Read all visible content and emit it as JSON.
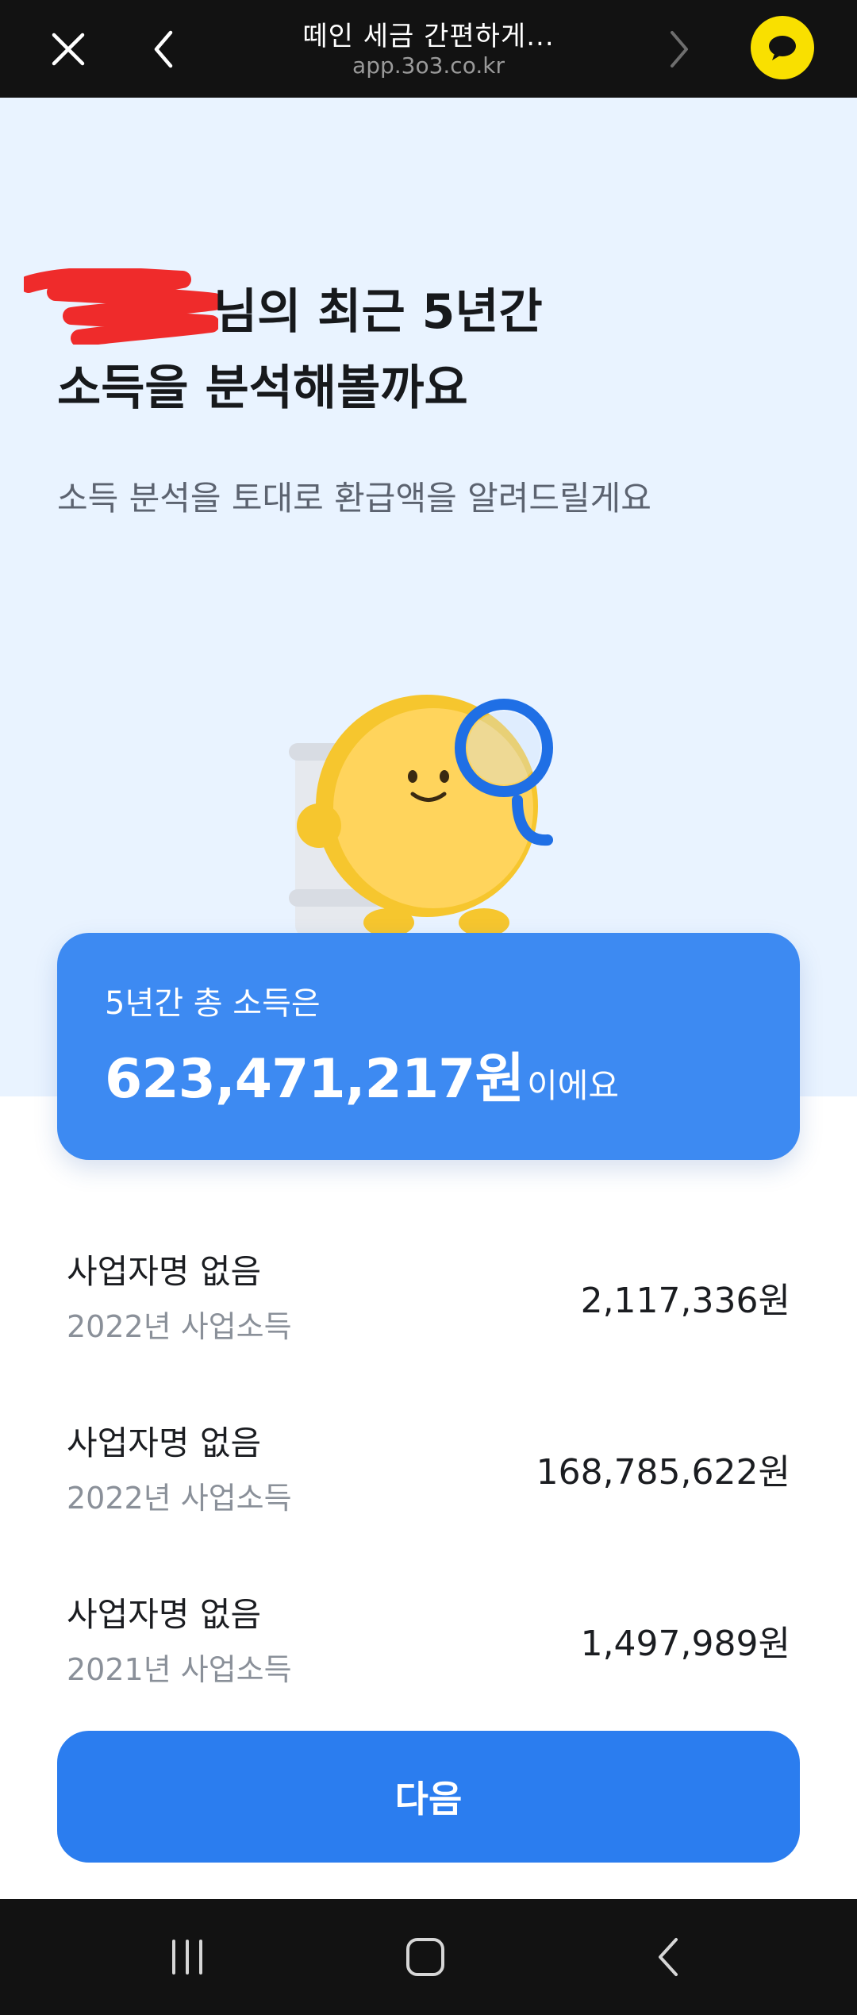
{
  "browser": {
    "title": "떼인 세금 간편하게...",
    "url": "app.3o3.co.kr",
    "close_icon": "close-icon",
    "back_icon": "chevron-left-icon",
    "forward_icon": "chevron-right-icon",
    "chat_icon": "chat-bubble-icon"
  },
  "hero": {
    "headline_line1": "님의 최근 5년간",
    "headline_line2": "소득을 분석해볼까요",
    "subtitle": "소득 분석을 토대로 환급액을 알려드릴게요"
  },
  "total": {
    "label": "5년간 총 소득은",
    "amount": "623,471,217원",
    "suffix": "이에요"
  },
  "incomes": [
    {
      "name": "사업자명 없음",
      "desc": "2022년 사업소득",
      "amount": "2,117,336원"
    },
    {
      "name": "사업자명 없음",
      "desc": "2022년 사업소득",
      "amount": "168,785,622원"
    },
    {
      "name": "사업자명 없음",
      "desc": "2021년 사업소득",
      "amount": "1,497,989원"
    }
  ],
  "next_button": {
    "label": "다음"
  },
  "nav": {
    "recent_icon": "recent-apps-icon",
    "home_icon": "home-icon",
    "back_icon": "back-icon"
  },
  "colors": {
    "accent": "#2b7def",
    "card": "#3d8af2",
    "hero_bg": "#e9f3ff",
    "chat": "#f9e000"
  }
}
